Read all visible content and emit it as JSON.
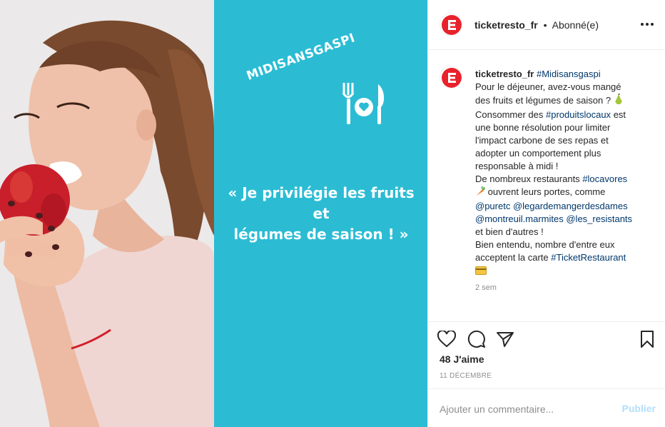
{
  "media": {
    "tag": "MIDISANSGASPI",
    "quote_lines": [
      "« Je privilégie les fruits",
      "et",
      "légumes de saison ! »"
    ]
  },
  "header": {
    "username": "ticketresto_fr",
    "separator": "•",
    "follow_status": "Abonné(e)"
  },
  "caption": {
    "username": "ticketresto_fr",
    "hashtag": "#Midisansgaspi",
    "lines": {
      "l1": "Pour le déjeuner, avez-vous mangé",
      "l2": "des fruits et légumes de saison ?",
      "l3a": "Consommer des",
      "l3b": "#produitslocaux",
      "l3c": "est",
      "l4": "une bonne résolution pour limiter",
      "l5": "l'impact carbone de ses repas et",
      "l6": "adopter un comportement plus",
      "l7": "responsable à midi !",
      "l8a": "De nombreux restaurants",
      "l8b": "#locavores",
      "l9": "ouvrent leurs portes, comme",
      "l10a": "@puretc",
      "l10b": "@legardemangerdesdames",
      "l11a": "@montreuil.marmites",
      "l11b": "@les_resistants",
      "l12": "et bien d'autres !",
      "l13": "Bien entendu, nombre d'entre eux",
      "l14a": "acceptent la carte",
      "l14b": "#TicketRestaurant"
    },
    "time_ago": "2 sem"
  },
  "engagement": {
    "likes": "48 J'aime",
    "date": "11 DÉCEMBRE"
  },
  "comment": {
    "placeholder": "Ajouter un commentaire...",
    "publish_label": "Publier"
  },
  "icons": {
    "brand_logo": "ticketresto-logo-icon",
    "more": "more-options-icon",
    "like": "heart-icon",
    "comment": "comment-icon",
    "share": "share-icon",
    "save": "bookmark-icon",
    "cutlery": "cutlery-heart-icon"
  },
  "colors": {
    "brand_red": "#e8212b",
    "graphic_bg": "#2bbcd4",
    "link": "#00376b",
    "publish_disabled": "#b2dffc"
  }
}
